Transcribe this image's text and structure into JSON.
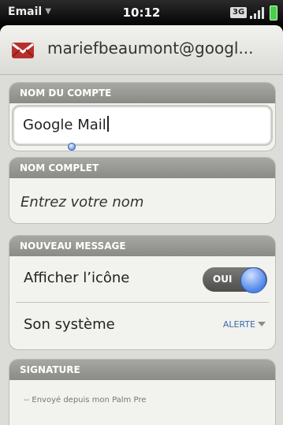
{
  "status_bar": {
    "app_menu": "Email",
    "time": "10:12",
    "network": "3G"
  },
  "header": {
    "account": "mariefbeaumont@googl..."
  },
  "sections": {
    "account_name": {
      "title": "NOM DU COMPTE",
      "value": "Google Mail"
    },
    "full_name": {
      "title": "NOM COMPLET",
      "placeholder": "Entrez votre nom"
    },
    "new_message": {
      "title": "NOUVEAU MESSAGE",
      "show_icon_label": "Afficher l’icône",
      "show_icon_toggle": "OUI",
      "system_sound_label": "Son système",
      "system_sound_value": "ALERTE"
    },
    "signature": {
      "title": "SIGNATURE",
      "value": "-- Envoyé depuis mon Palm Pre"
    }
  },
  "icons": [
    "chevron-down-icon",
    "signal-bars-icon",
    "battery-icon",
    "mail-envelope-icon",
    "dropdown-arrow-icon"
  ]
}
